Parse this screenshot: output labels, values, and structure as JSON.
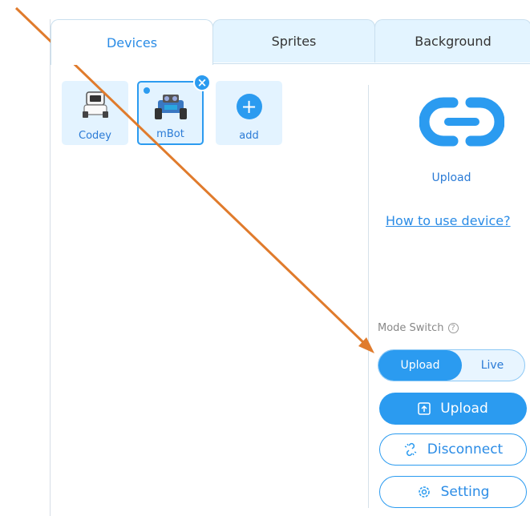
{
  "tabs": [
    {
      "label": "Devices",
      "active": true
    },
    {
      "label": "Sprites",
      "active": false
    },
    {
      "label": "Background",
      "active": false
    }
  ],
  "devices": [
    {
      "label": "Codey",
      "selected": false
    },
    {
      "label": "mBot",
      "selected": true
    },
    {
      "label": "add",
      "selected": false
    }
  ],
  "connection": {
    "caption": "Upload",
    "help_link": "How to use device?"
  },
  "mode_switch": {
    "label": "Mode Switch",
    "options": [
      "Upload",
      "Live"
    ],
    "selected": "Upload"
  },
  "buttons": {
    "upload": "Upload",
    "disconnect": "Disconnect",
    "setting": "Setting"
  },
  "colors": {
    "accent": "#2b9bf0",
    "annotation_arrow": "#e07b2c"
  }
}
